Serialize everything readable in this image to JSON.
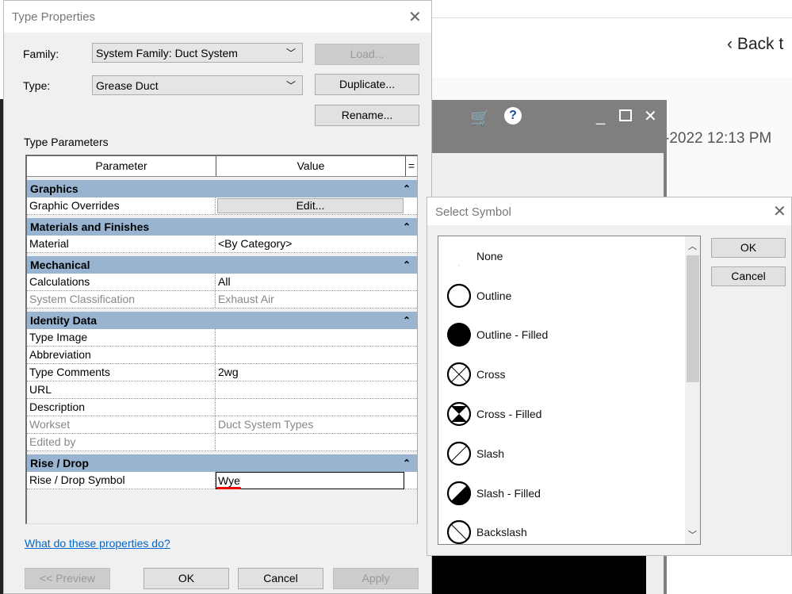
{
  "background": {
    "back_link": "Back t",
    "date": "-2022 12:13 PM"
  },
  "type_properties": {
    "title": "Type Properties",
    "family_label": "Family:",
    "family_value": "System Family: Duct System",
    "type_label": "Type:",
    "type_value": "Grease Duct",
    "load_label": "Load...",
    "duplicate_label": "Duplicate...",
    "rename_label": "Rename...",
    "section_label": "Type Parameters",
    "col_parameter": "Parameter",
    "col_value": "Value",
    "col_sort": "=",
    "groups": [
      {
        "name": "Graphics",
        "rows": [
          {
            "p": "Graphic Overrides",
            "v": "Edit...",
            "button": true
          }
        ]
      },
      {
        "name": "Materials and Finishes",
        "rows": [
          {
            "p": "Material",
            "v": "<By Category>"
          }
        ]
      },
      {
        "name": "Mechanical",
        "rows": [
          {
            "p": "Calculations",
            "v": "All"
          },
          {
            "p": "System Classification",
            "v": "Exhaust Air",
            "readonly": true
          }
        ]
      },
      {
        "name": "Identity Data",
        "rows": [
          {
            "p": "Type Image",
            "v": ""
          },
          {
            "p": "Abbreviation",
            "v": ""
          },
          {
            "p": "Type Comments",
            "v": "2wg"
          },
          {
            "p": "URL",
            "v": ""
          },
          {
            "p": "Description",
            "v": ""
          },
          {
            "p": "Workset",
            "v": "Duct System Types",
            "readonly": true
          },
          {
            "p": "Edited by",
            "v": "",
            "readonly": true
          }
        ]
      },
      {
        "name": "Rise / Drop",
        "rows": [
          {
            "p": "Rise / Drop Symbol",
            "v": "Wye",
            "editing": true
          }
        ]
      }
    ],
    "collapse_glyph": "⌃",
    "help_link": "What do these properties do?",
    "preview_label": "<< Preview",
    "ok_label": "OK",
    "cancel_label": "Cancel",
    "apply_label": "Apply"
  },
  "select_symbol": {
    "title": "Select Symbol",
    "ok_label": "OK",
    "cancel_label": "Cancel",
    "items": [
      {
        "label": "None",
        "icon": "none"
      },
      {
        "label": "Outline",
        "icon": "outline"
      },
      {
        "label": "Outline - Filled",
        "icon": "outline-filled"
      },
      {
        "label": "Cross",
        "icon": "cross"
      },
      {
        "label": "Cross - Filled",
        "icon": "cross-filled"
      },
      {
        "label": "Slash",
        "icon": "slash"
      },
      {
        "label": "Slash - Filled",
        "icon": "slash-filled"
      },
      {
        "label": "Backslash",
        "icon": "backslash"
      }
    ]
  },
  "colors": {
    "group_header": "#99b4d1",
    "link": "#0066cc",
    "annotation": "#e00000"
  }
}
